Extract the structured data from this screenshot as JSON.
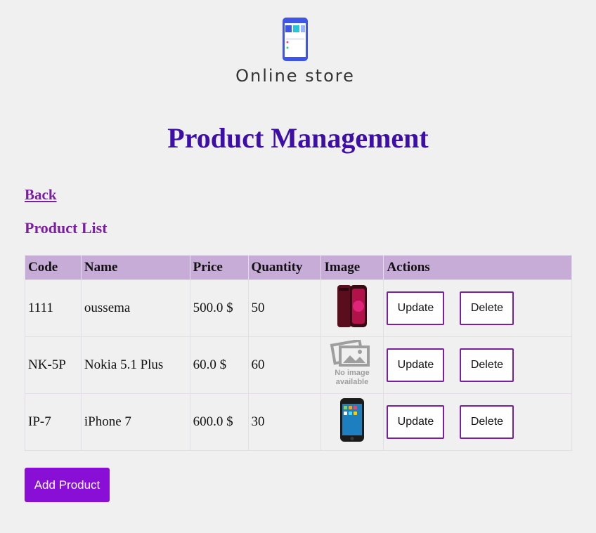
{
  "logo": {
    "text": "Online store",
    "icon": "store-phone-icon"
  },
  "page_title": "Product Management",
  "back_link": "Back",
  "list_title": "Product List",
  "table": {
    "headers": [
      "Code",
      "Name",
      "Price",
      "Quantity",
      "Image",
      "Actions"
    ],
    "rows": [
      {
        "code": "1111",
        "name": "oussema",
        "price": "500.0 $",
        "quantity": "50",
        "image": "phone-red-image",
        "update": "Update",
        "delete": "Delete"
      },
      {
        "code": "NK-5P",
        "name": "Nokia 5.1 Plus",
        "price": "60.0 $",
        "quantity": "60",
        "image": "no-image-placeholder",
        "no_image_text_1": "No image",
        "no_image_text_2": "available",
        "update": "Update",
        "delete": "Delete"
      },
      {
        "code": "IP-7",
        "name": "iPhone 7",
        "price": "600.0 $",
        "quantity": "30",
        "image": "iphone-black-image",
        "update": "Update",
        "delete": "Delete"
      }
    ]
  },
  "add_button": "Add Product",
  "colors": {
    "accent": "#7b1fa2",
    "title": "#3d0fa8",
    "header_bg": "#c6acd6",
    "add_button_bg": "#8a0fd6"
  }
}
